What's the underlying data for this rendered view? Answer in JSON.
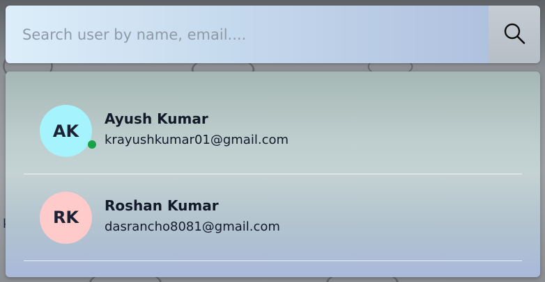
{
  "search": {
    "placeholder": "Search user by name, email....",
    "value": "",
    "button_icon": "search-icon"
  },
  "users": [
    {
      "initials": "AK",
      "name": "Ayush Kumar",
      "email": "krayushkumar01@gmail.com",
      "avatar_color": "#a5f3fc",
      "online": true,
      "status_color": "#16a34a"
    },
    {
      "initials": "RK",
      "name": "Roshan Kumar",
      "email": "dasrancho8081@gmail.com",
      "avatar_color": "#fecaca",
      "online": false
    }
  ]
}
